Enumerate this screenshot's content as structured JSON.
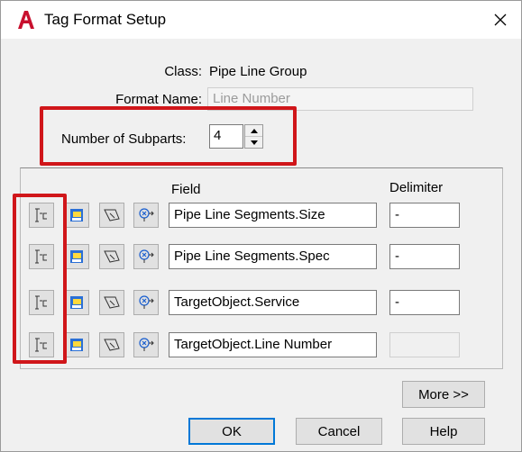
{
  "window": {
    "title": "Tag Format Setup",
    "close_glyph": "✕",
    "app_icon": "autocad-a-logo"
  },
  "form": {
    "class_label": "Class:",
    "class_value": "Pipe Line Group",
    "format_name_label": "Format Name:",
    "format_name_value": "Line Number",
    "subparts_label": "Number of Subparts:",
    "subparts_value": "4"
  },
  "table": {
    "field_header": "Field",
    "delimiter_header": "Delimiter",
    "row_icons": [
      "edit-subpart-icon",
      "select-property-icon",
      "delete-subpart-icon",
      "pick-object-icon"
    ],
    "rows": [
      {
        "field": "Pipe Line Segments.Size",
        "delimiter": "-"
      },
      {
        "field": "Pipe Line Segments.Spec",
        "delimiter": "-"
      },
      {
        "field": "TargetObject.Service",
        "delimiter": "-"
      },
      {
        "field": "TargetObject.Line Number",
        "delimiter": ""
      }
    ]
  },
  "buttons": {
    "more": "More >>",
    "ok": "OK",
    "cancel": "Cancel",
    "help": "Help"
  },
  "colors": {
    "highlight": "#d0161a",
    "logo_red": "#c8102e",
    "focus_blue": "#0078d7"
  }
}
